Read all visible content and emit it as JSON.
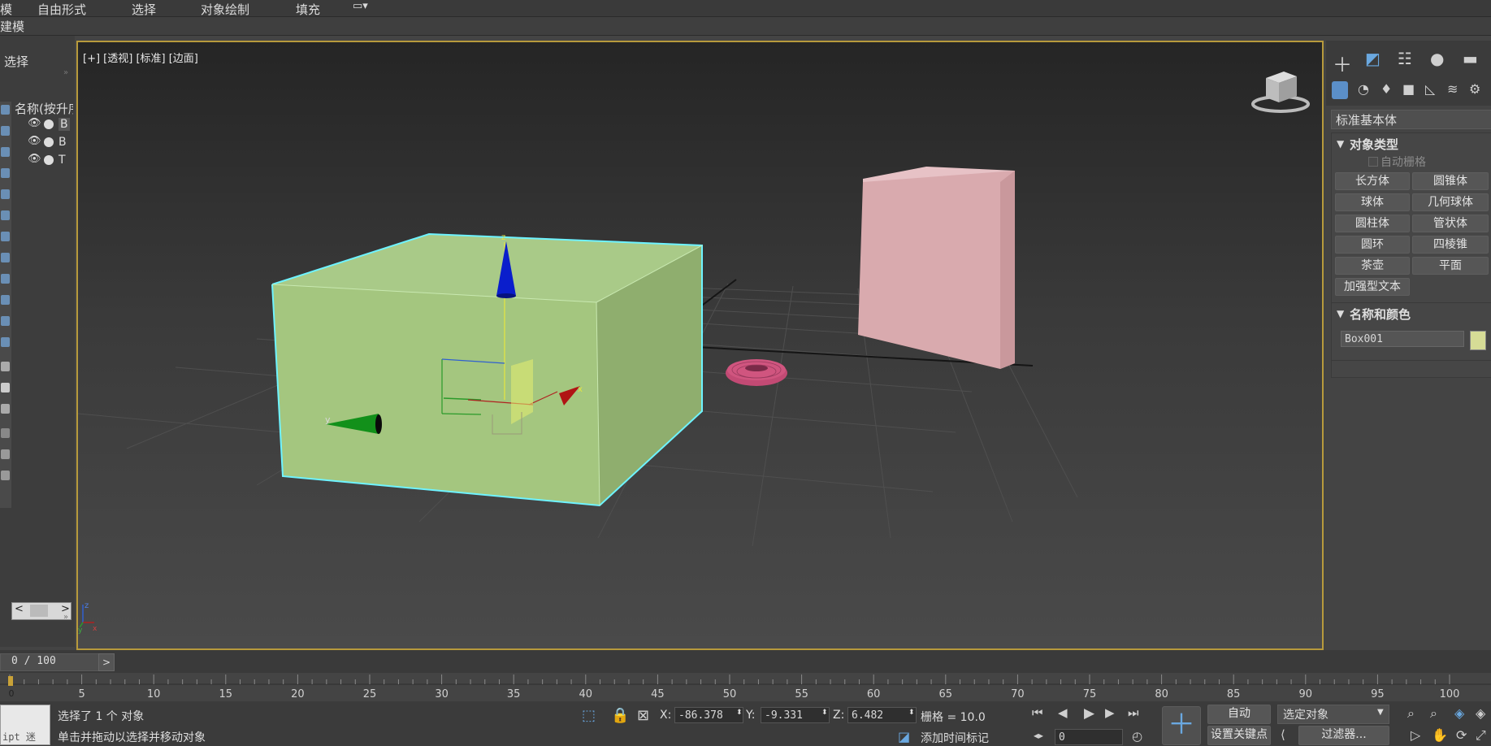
{
  "ribbon": {
    "left_fragment": "模",
    "tabs": [
      "自由形式",
      "选择",
      "对象绘制",
      "填充"
    ],
    "subtab": "建模"
  },
  "scene_explorer": {
    "select_label": "选择",
    "column_header": "名称(按升序",
    "rows": [
      {
        "name": "B"
      },
      {
        "name": "B"
      },
      {
        "name": "T"
      }
    ]
  },
  "viewport": {
    "label": "[+] [透视] [标准] [边面]",
    "gizmo_x": "x",
    "gizmo_y": "y",
    "gizmo_z": "z"
  },
  "command_panel": {
    "dropdown": "标准基本体",
    "rollout_object_type": "对象类型",
    "auto_grid": "自动栅格",
    "buttons": [
      "长方体",
      "圆锥体",
      "球体",
      "几何球体",
      "圆柱体",
      "管状体",
      "圆环",
      "四棱锥",
      "茶壶",
      "平面"
    ],
    "extended_text": "加强型文本",
    "rollout_name_color": "名称和颜色",
    "object_name": "Box001",
    "object_color": "#d6dc96"
  },
  "timeline": {
    "frame_display": "0 / 100",
    "ticks": [
      5,
      10,
      15,
      20,
      25,
      30,
      35,
      40,
      45,
      50,
      55,
      60,
      65,
      70,
      75,
      80,
      85,
      90,
      95,
      100
    ],
    "zero": "0"
  },
  "status": {
    "script_box": "ipt 迷",
    "selection_text": "选择了 1 个 对象",
    "prompt_text": "单击并拖动以选择并移动对象",
    "x_label": "X:",
    "x_value": "-86.378",
    "y_label": "Y:",
    "y_value": "-9.331",
    "z_label": "Z:",
    "z_value": "6.482",
    "grid_text": "栅格 = 10.0",
    "add_time_tag": "添加时间标记",
    "auto_key": "自动",
    "set_key": "设置关键点",
    "key_mode": "选定对象",
    "filters": "过滤器...",
    "frame_value": "0"
  },
  "colors": {
    "selected_box": "#a4c67f",
    "pink_box": "#d9aaae",
    "torus": "#d0557f",
    "viewport_border": "#b79a3c",
    "highlight_edge": "#6ef3ff"
  }
}
